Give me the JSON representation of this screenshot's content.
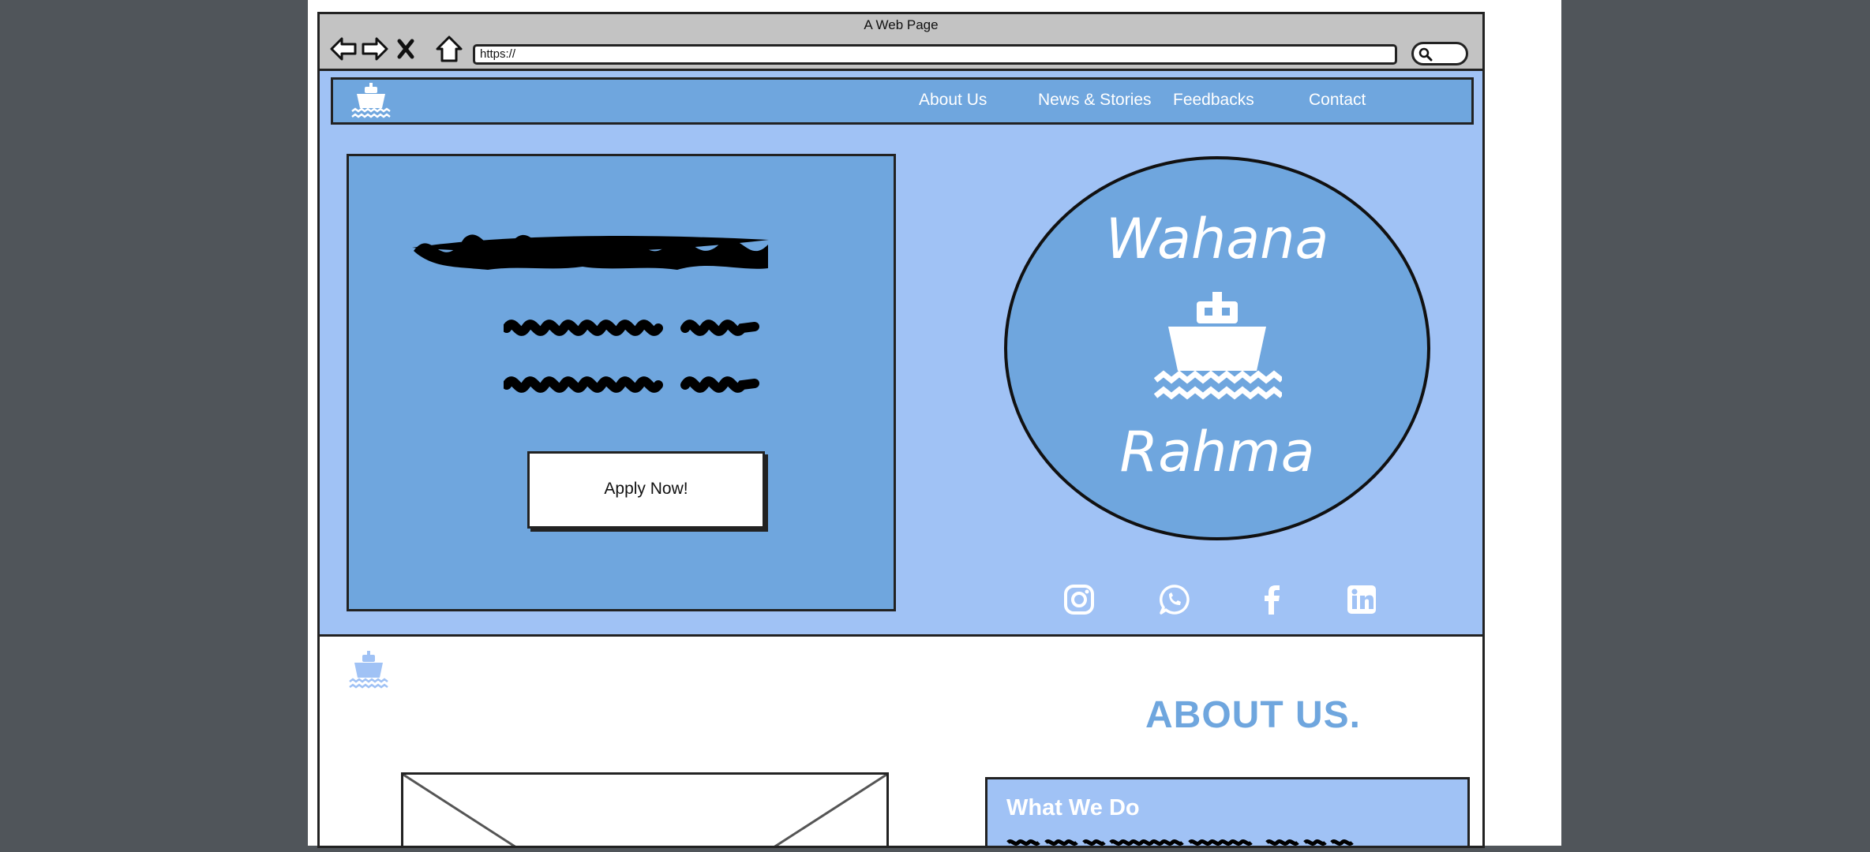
{
  "window": {
    "title": "A Web Page",
    "url": "https://"
  },
  "navbar": {
    "links": [
      "About Us",
      "News & Stories",
      "Feedbacks",
      "Contact"
    ]
  },
  "hero": {
    "cta_label": "Apply Now!",
    "brand": {
      "line1": "Wahana",
      "line2": "Rahma"
    },
    "social_icons": [
      "instagram-icon",
      "whatsapp-icon",
      "facebook-icon",
      "linkedin-icon"
    ]
  },
  "about": {
    "heading": "ABOUT US.",
    "card_title": "What We Do"
  },
  "colors": {
    "nav_blue": "#6fa6de",
    "light_blue": "#a0c2f5",
    "chrome_gray": "#c3c3c3",
    "outer_bg": "#50555a"
  }
}
